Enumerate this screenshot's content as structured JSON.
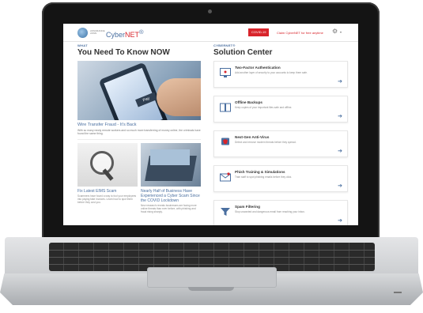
{
  "site": {
    "brand_prefix": "Cyber",
    "brand_suffix": "NET",
    "brand_tm": "®",
    "logo_text": "ASSURANCE ASSN",
    "covid_label": "COVID-19",
    "promo_text": "Claim CyberNET for free anytime",
    "gear_icon": "⚙",
    "caret_icon": "▾"
  },
  "left": {
    "kicker": "WHAT",
    "heading": "You Need To Know NOW",
    "hero_button": "Pay",
    "article": {
      "title": "Wire Transfer Fraud - It’s Back",
      "body": "With so many newly remote workers and so much more transferring of money online, the criminals have found the same thing."
    },
    "cards": [
      {
        "title": "Fix Latest EIMS Scam",
        "body": "Scammers have found a way to fool your employees into paying fake invoices. Learn how to spot them before they cost you."
      },
      {
        "title": "Nearly Half of Business Have Experienced a Cyber Scam Since the COVID Lockdown",
        "body": "New research reveals businesses are facing more online threats than ever before, with phishing and fraud rising sharply."
      }
    ]
  },
  "right": {
    "kicker": "CYBERNET®",
    "heading": "Solution Center",
    "items": [
      {
        "title": "Two-Factor Authentication",
        "desc": "Add another layer of security to your accounts to keep them safe."
      },
      {
        "title": "Offline Backups",
        "desc": "Keep copies of your important files safe and offline."
      },
      {
        "title": "Next-Gen Anti-Virus",
        "desc": "Detect and remove modern threats before they spread."
      },
      {
        "title": "Phish Training & Simulations",
        "desc": "Train staff to spot phishing emails before they click."
      },
      {
        "title": "Spam Filtering",
        "desc": "Stop unwanted and dangerous email from reaching your inbox."
      }
    ],
    "arrow_icon": "➔"
  },
  "colors": {
    "accent": "#4a6fa0",
    "brand_red": "#d8242b",
    "laptop_body": "#141414"
  }
}
